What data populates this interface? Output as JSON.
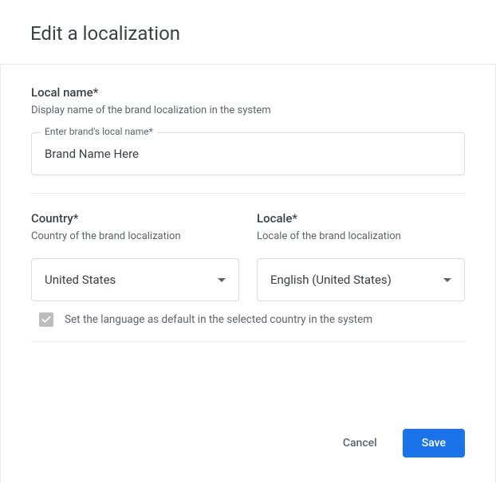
{
  "dialog": {
    "title": "Edit a localization"
  },
  "localName": {
    "label": "Local name*",
    "description": "Display name of the brand localization in the system",
    "floatingLabel": "Enter brand's local name*",
    "value": "Brand Name Here"
  },
  "country": {
    "label": "Country*",
    "description": "Country of the brand localization",
    "value": "United States"
  },
  "locale": {
    "label": "Locale*",
    "description": "Locale of the brand localization",
    "value": "English (United States)"
  },
  "defaultLang": {
    "label": "Set the language as default in the selected country in the system",
    "checked": true
  },
  "footer": {
    "cancel": "Cancel",
    "save": "Save"
  }
}
